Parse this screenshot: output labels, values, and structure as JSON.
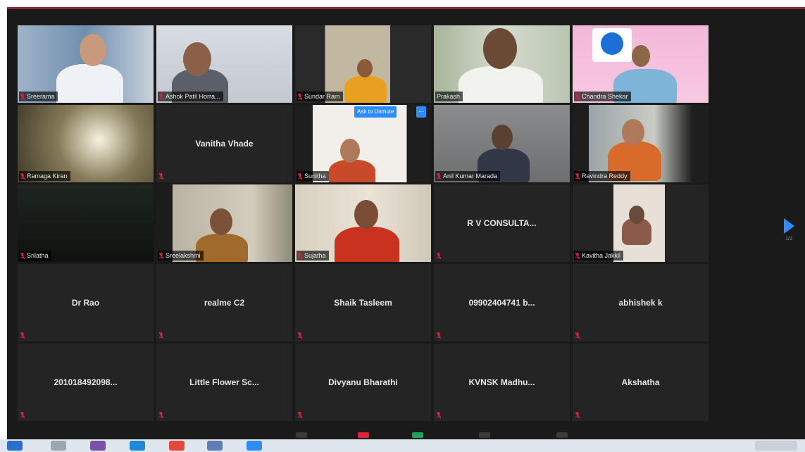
{
  "app": {
    "accent": "#2d8cff",
    "active_speaker_color": "#c9c24a",
    "muted_color": "#e0223a"
  },
  "participants": [
    {
      "name": "Sreerama",
      "video": true,
      "muted": true
    },
    {
      "name": "Ashok Patil Horra...",
      "video": true,
      "muted": true
    },
    {
      "name": "Sundar Ram",
      "video": true,
      "muted": true
    },
    {
      "name": "Prakash",
      "video": true,
      "muted": false,
      "active": true
    },
    {
      "name": "Chandra Shekar",
      "video": true,
      "muted": true
    },
    {
      "name": "Ramaga Kiran",
      "video": true,
      "muted": true
    },
    {
      "name": "Vanitha Vhade",
      "video": false,
      "muted": true
    },
    {
      "name": "Sunitha",
      "video": true,
      "muted": true,
      "chip": "Ask to Unmute"
    },
    {
      "name": "Anil Kumar Marada",
      "video": true,
      "muted": true
    },
    {
      "name": "Ravindra Reddy",
      "video": true,
      "muted": true
    },
    {
      "name": "Srilatha",
      "video": true,
      "muted": true
    },
    {
      "name": "Sreelakshmi",
      "video": true,
      "muted": true
    },
    {
      "name": "Sujatha",
      "video": true,
      "muted": true
    },
    {
      "name": "R V CONSULTA...",
      "video": false,
      "muted": true
    },
    {
      "name": "Kavitha Jakkil",
      "video": true,
      "muted": true
    },
    {
      "name": "Dr Rao",
      "video": false,
      "muted": true
    },
    {
      "name": "realme C2",
      "video": false,
      "muted": true
    },
    {
      "name": "Shaik Tasleem",
      "video": false,
      "muted": true
    },
    {
      "name": "09902404741 b...",
      "video": false,
      "muted": true
    },
    {
      "name": "abhishek k",
      "video": false,
      "muted": true
    },
    {
      "name": "201018492098...",
      "video": false,
      "muted": true
    },
    {
      "name": "Little Flower Sc...",
      "video": false,
      "muted": true
    },
    {
      "name": "Divyanu Bharathi",
      "video": false,
      "muted": true
    },
    {
      "name": "KVNSK Madhu...",
      "video": false,
      "muted": true
    },
    {
      "name": "Akshatha",
      "video": false,
      "muted": true
    }
  ],
  "next_page": {
    "label": "1/2"
  }
}
